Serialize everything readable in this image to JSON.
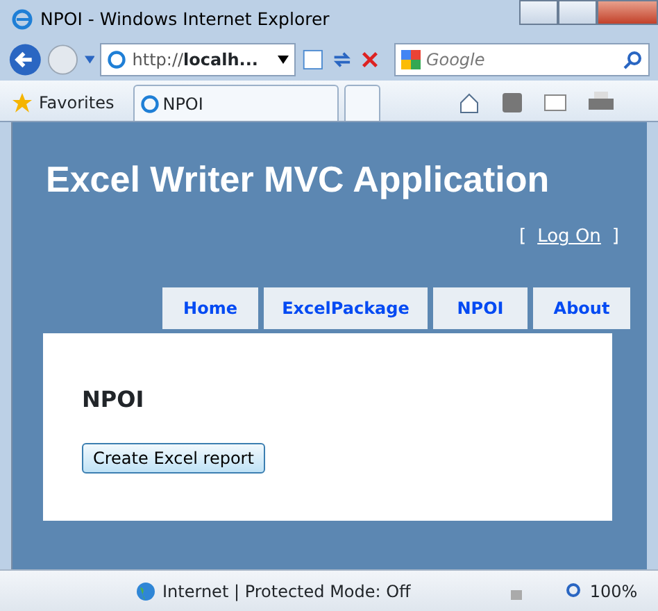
{
  "window": {
    "title": "NPOI - Windows Internet Explorer"
  },
  "address_bar": {
    "url_prefix": "http://",
    "url_host": "localh...",
    "search_placeholder": "Google"
  },
  "favorites_bar": {
    "favorites": "Favorites",
    "tab_title": "NPOI"
  },
  "page": {
    "title": "Excel Writer MVC Application",
    "login": {
      "open": "[",
      "link": "Log On",
      "close": "]"
    },
    "menu": [
      {
        "label": "Home"
      },
      {
        "label": "ExcelPackage"
      },
      {
        "label": "NPOI"
      },
      {
        "label": "About"
      }
    ],
    "heading": "NPOI",
    "button": "Create Excel report"
  },
  "status_bar": {
    "zone": "Internet | Protected Mode: Off",
    "zoom": "100%"
  }
}
